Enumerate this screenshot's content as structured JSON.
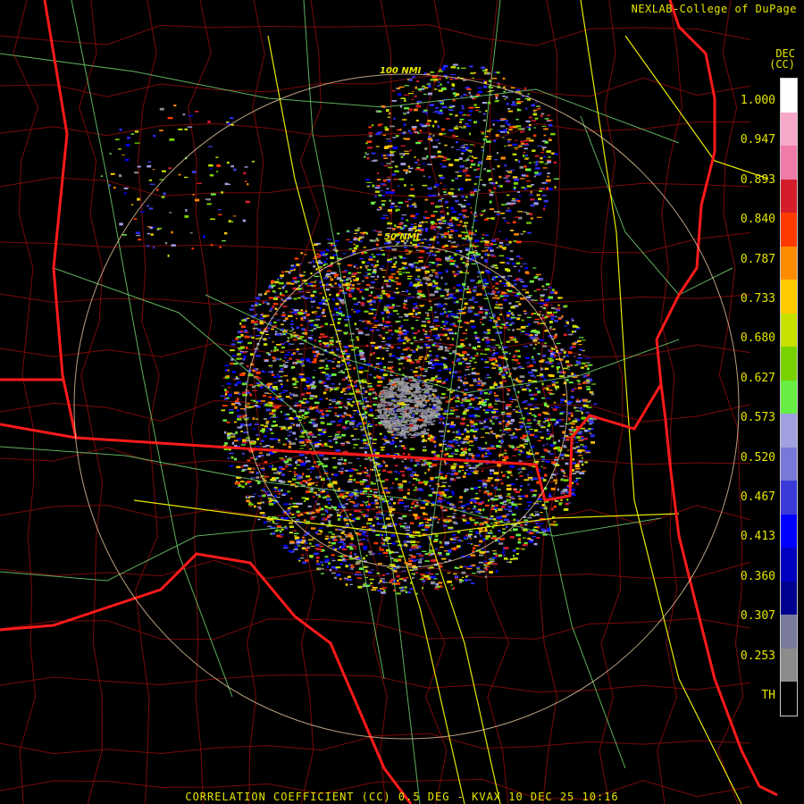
{
  "header": {
    "credit": "NEXLAB-College of DuPage"
  },
  "unit": {
    "line1": "DEC",
    "line2": "(CC)"
  },
  "legend": {
    "labels": [
      "1.000",
      "0.947",
      "0.893",
      "0.840",
      "0.787",
      "0.733",
      "0.680",
      "0.627",
      "0.573",
      "0.520",
      "0.467",
      "0.413",
      "0.360",
      "0.307",
      "0.253",
      "TH"
    ],
    "colors": [
      "#ffffff",
      "#f7a8c8",
      "#f07aa8",
      "#d41c2a",
      "#ff3a00",
      "#ff8c00",
      "#ffcc00",
      "#c8e000",
      "#78d200",
      "#66ee44",
      "#a0a0e0",
      "#7878d8",
      "#3a3ad8",
      "#0000ff",
      "#0000c0",
      "#000090",
      "#7a7a9a",
      "#8c8c8c",
      "#000000"
    ]
  },
  "rings": {
    "label_50": "50 NMI",
    "label_100": "100 NMI"
  },
  "footer": {
    "text": "CORRELATION COEFFICIENT (CC) 0.5 DEG - KVAX 10 DEC 25 10:16"
  }
}
